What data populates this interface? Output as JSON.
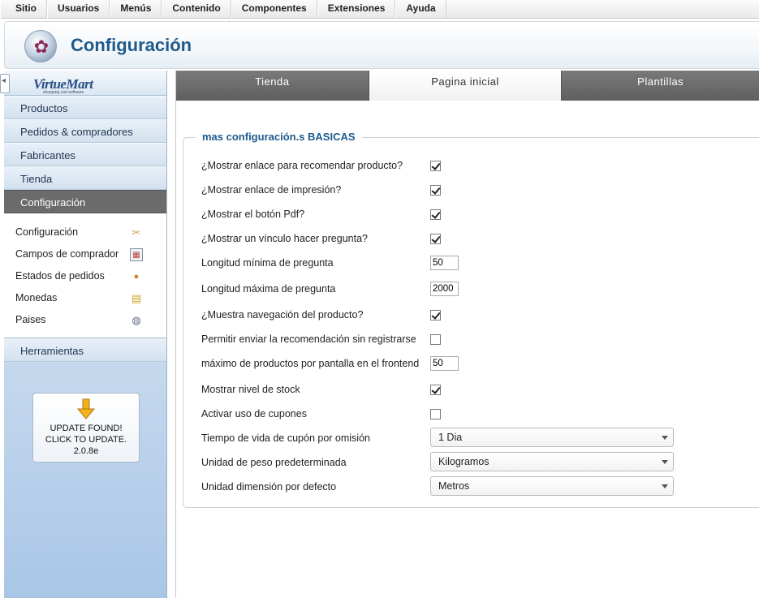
{
  "topmenu": {
    "items": [
      {
        "label": "Sitio"
      },
      {
        "label": "Usuarios"
      },
      {
        "label": "Menús"
      },
      {
        "label": "Contenido"
      },
      {
        "label": "Componentes"
      },
      {
        "label": "Extensiones"
      },
      {
        "label": "Ayuda"
      }
    ]
  },
  "header": {
    "title": "Configuración",
    "logo_icon": "virtuemart-joomla-logo"
  },
  "sidebar": {
    "brand": "VirtueMart",
    "brand_tagline": "shopping cart software",
    "items": [
      {
        "label": "Productos"
      },
      {
        "label": "Pedidos & compradores"
      },
      {
        "label": "Fabricantes"
      },
      {
        "label": "Tienda"
      },
      {
        "label": "Configuración"
      }
    ],
    "submenu": [
      {
        "label": "Configuración",
        "icon": "tools-icon"
      },
      {
        "label": "Campos de comprador",
        "icon": "form-fields-icon"
      },
      {
        "label": "Estados de pedidos",
        "icon": "order-status-icon"
      },
      {
        "label": "Monedas",
        "icon": "coins-icon"
      },
      {
        "label": "Paises",
        "icon": "globe-icon"
      }
    ],
    "tools": "Herramientas",
    "update": {
      "text": "UPDATE FOUND! CLICK TO UPDATE.",
      "version": "2.0.8e"
    }
  },
  "tabs": [
    {
      "label": "Tienda"
    },
    {
      "label": "Pagina inicial"
    },
    {
      "label": "Plantillas"
    }
  ],
  "fieldset": {
    "legend": "mas configuración.s BASICAS",
    "rows": [
      {
        "label": "¿Mostrar enlace para recomendar producto?",
        "type": "checkbox",
        "checked": true
      },
      {
        "label": "¿Mostrar enlace de impresión?",
        "type": "checkbox",
        "checked": true
      },
      {
        "label": "¿Mostrar el botón Pdf?",
        "type": "checkbox",
        "checked": true
      },
      {
        "label": "¿Mostrar un vínculo hacer pregunta?",
        "type": "checkbox",
        "checked": true
      },
      {
        "label": "Longitud mínima de pregunta",
        "type": "text",
        "value": "50"
      },
      {
        "label": "Longitud máxima de pregunta",
        "type": "text",
        "value": "2000"
      },
      {
        "label": "¿Muestra navegación del producto?",
        "type": "checkbox",
        "checked": true
      },
      {
        "label": "Permitir enviar la recomendación sin registrarse",
        "type": "checkbox",
        "checked": false
      },
      {
        "label": "máximo de productos por pantalla en el frontend",
        "type": "text",
        "value": "50"
      },
      {
        "label": "Mostrar nivel de stock",
        "type": "checkbox",
        "checked": true
      },
      {
        "label": "Activar uso de cupones",
        "type": "checkbox",
        "checked": false
      },
      {
        "label": "Tiempo de vida de cupón por omisión",
        "type": "select",
        "value": "1 Dia"
      },
      {
        "label": "Unidad de peso predeterminada",
        "type": "select",
        "value": "Kilogramos"
      },
      {
        "label": "Unidad dimensión por defecto",
        "type": "select",
        "value": "Metros"
      }
    ]
  },
  "colors": {
    "accent": "#1e5a8c",
    "tab_bg": "#6e6e6e",
    "sidebar_active": "#6b6b6b"
  }
}
